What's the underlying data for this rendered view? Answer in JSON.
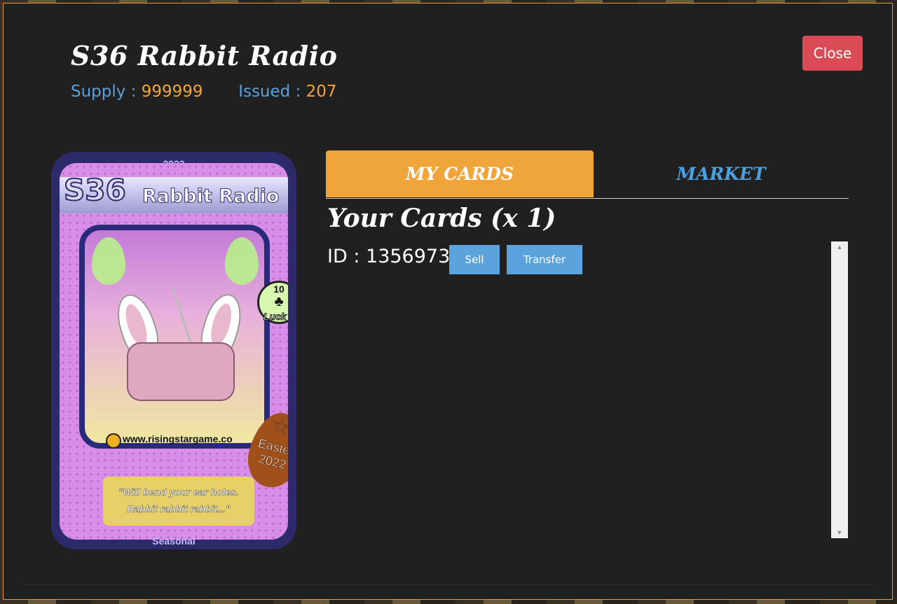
{
  "modal": {
    "title": "S36 Rabbit Radio",
    "supply_label": "Supply :",
    "supply_value": "999999",
    "issued_label": "Issued :",
    "issued_value": "207",
    "close_label": "Close"
  },
  "card": {
    "year": "2022",
    "code": "S36",
    "name": "Rabbit Radio",
    "luck_value": "10",
    "luck_label": "Luck",
    "website": "www.risingstargame.co",
    "badge_line1": "Easter",
    "badge_line2": "2022",
    "quote_line1": "\"Will bend your ear holes.",
    "quote_line2": "Rabbit rabbit rabbit...\"",
    "type": "Seasonal"
  },
  "tabs": {
    "my_cards": "MY CARDS",
    "market": "MARKET"
  },
  "my_cards": {
    "heading": "Your Cards (x 1)",
    "items": [
      {
        "id_label": "ID : 1356973",
        "sell_label": "Sell",
        "transfer_label": "Transfer"
      }
    ]
  },
  "colors": {
    "accent_orange": "#f0a53a",
    "accent_blue": "#5aa0dc",
    "close_red": "#d94b55",
    "panel_bg": "#202020"
  },
  "icons": [
    "star-icon",
    "clover-icon",
    "scroll-up-icon",
    "scroll-down-icon"
  ]
}
